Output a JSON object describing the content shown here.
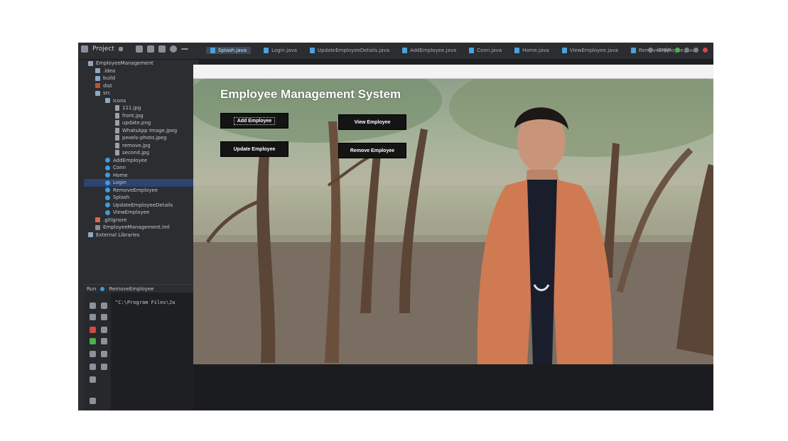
{
  "ide": {
    "toolbar": {
      "project_menu": "Project",
      "tabs": [
        {
          "label": "Splash.java",
          "active": true
        },
        {
          "label": "Login.java",
          "active": false
        },
        {
          "label": "UpdateEmployeeDetails.java",
          "active": false
        },
        {
          "label": "AddEmployee.java",
          "active": false
        },
        {
          "label": "Conn.java",
          "active": false
        },
        {
          "label": "Home.java",
          "active": false
        },
        {
          "label": "ViewEmployee.java",
          "active": false
        },
        {
          "label": "RemoveEmployee.java",
          "active": false
        }
      ],
      "run_config": "Login"
    },
    "project_tree": [
      {
        "label": "EmployeeManagement",
        "icon": "folder-icon",
        "indent": 0
      },
      {
        "label": ".idea",
        "icon": "folder-icon",
        "indent": 1
      },
      {
        "label": "build",
        "icon": "folder-icon",
        "indent": 1
      },
      {
        "label": "dist",
        "icon": "folder-red-icon",
        "indent": 1
      },
      {
        "label": "src",
        "icon": "folder-icon",
        "indent": 1
      },
      {
        "label": "icons",
        "icon": "folder-icon",
        "indent": 2
      },
      {
        "label": "111.jpg",
        "icon": "image-icon",
        "indent": 3
      },
      {
        "label": "front.jpg",
        "icon": "image-icon",
        "indent": 3
      },
      {
        "label": "update.png",
        "icon": "image-icon",
        "indent": 3
      },
      {
        "label": "WhatsApp Image.jpeg",
        "icon": "image-icon",
        "indent": 3
      },
      {
        "label": "pexels-photo.jpeg",
        "icon": "image-icon",
        "indent": 3
      },
      {
        "label": "remove.jpg",
        "icon": "image-icon",
        "indent": 3
      },
      {
        "label": "second.jpg",
        "icon": "image-icon",
        "indent": 3
      },
      {
        "label": "AddEmployee",
        "icon": "java-class-icon",
        "indent": 2
      },
      {
        "label": "Conn",
        "icon": "java-class-icon",
        "indent": 2
      },
      {
        "label": "Home",
        "icon": "java-class-icon",
        "indent": 2
      },
      {
        "label": "Login",
        "icon": "java-class-icon",
        "indent": 2,
        "selected": true
      },
      {
        "label": "RemoveEmployee",
        "icon": "java-class-icon",
        "indent": 2
      },
      {
        "label": "Splash",
        "icon": "java-class-icon",
        "indent": 2
      },
      {
        "label": "UpdateEmployeeDetails",
        "icon": "java-class-icon",
        "indent": 2
      },
      {
        "label": "ViewEmployee",
        "icon": "java-class-icon",
        "indent": 2
      },
      {
        "label": ".gitignore",
        "icon": "git-icon",
        "indent": 1
      },
      {
        "label": "EmployeeManagement.iml",
        "icon": "xml-icon",
        "indent": 1
      },
      {
        "label": "External Libraries",
        "icon": "folder-icon",
        "indent": 0
      }
    ],
    "run_panel": {
      "run_label": "Run",
      "run_tab": "RemoveEmployee",
      "console_line": "\"C:\\Program Files\\Ja"
    }
  },
  "app": {
    "title": "Employee Management System",
    "buttons": {
      "add": "Add Employee",
      "view": "View Employee",
      "update": "Update Employee",
      "remove": "Remove Employee"
    }
  },
  "colors": {
    "ide_bg": "#1e1f22",
    "ide_panel": "#2b2d30",
    "selection": "#2e436e",
    "app_button": "#141414",
    "app_title": "#ffffff"
  }
}
